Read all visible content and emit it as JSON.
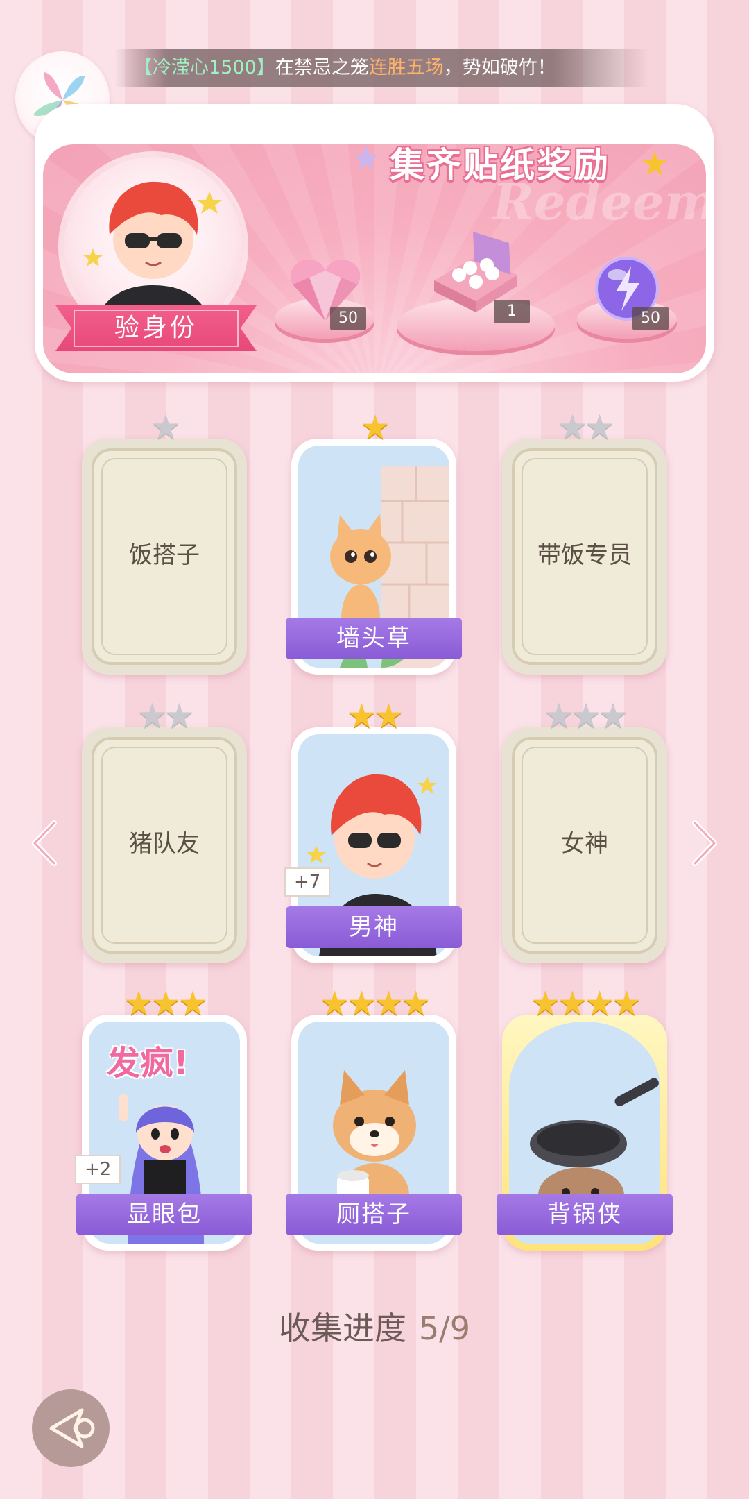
{
  "notice": {
    "player": "【冷滢心1500】",
    "text_before": "在禁忌之笼",
    "highlight": "连胜五场",
    "text_after": "，势如破竹！"
  },
  "banner": {
    "title": "集齐贴纸奖励",
    "script_text": "Redeem",
    "verify_label": "验身份",
    "rewards": [
      {
        "name": "heart-gem",
        "count": "50"
      },
      {
        "name": "gift-box",
        "count": "1"
      },
      {
        "name": "energy-orb",
        "count": "50"
      }
    ]
  },
  "cards": [
    {
      "label": "饭搭子",
      "stars": 1,
      "unlocked": false
    },
    {
      "label": "墙头草",
      "stars": 1,
      "unlocked": true
    },
    {
      "label": "带饭专员",
      "stars": 2,
      "unlocked": false
    },
    {
      "label": "猪队友",
      "stars": 2,
      "unlocked": false
    },
    {
      "label": "男神",
      "stars": 2,
      "unlocked": true,
      "plus": "+7"
    },
    {
      "label": "女神",
      "stars": 3,
      "unlocked": false
    },
    {
      "label": "显眼包",
      "stars": 3,
      "unlocked": true,
      "plus": "+2",
      "art_text": "发疯!"
    },
    {
      "label": "厕搭子",
      "stars": 4,
      "unlocked": true
    },
    {
      "label": "背锅侠",
      "stars": 4,
      "unlocked": true,
      "gold": true
    }
  ],
  "progress": {
    "label": "收集进度",
    "value": "5/9"
  },
  "colors": {
    "accent_purple": "#8a5bd6",
    "accent_pink": "#e7487a",
    "star_gold": "#f7c430"
  }
}
